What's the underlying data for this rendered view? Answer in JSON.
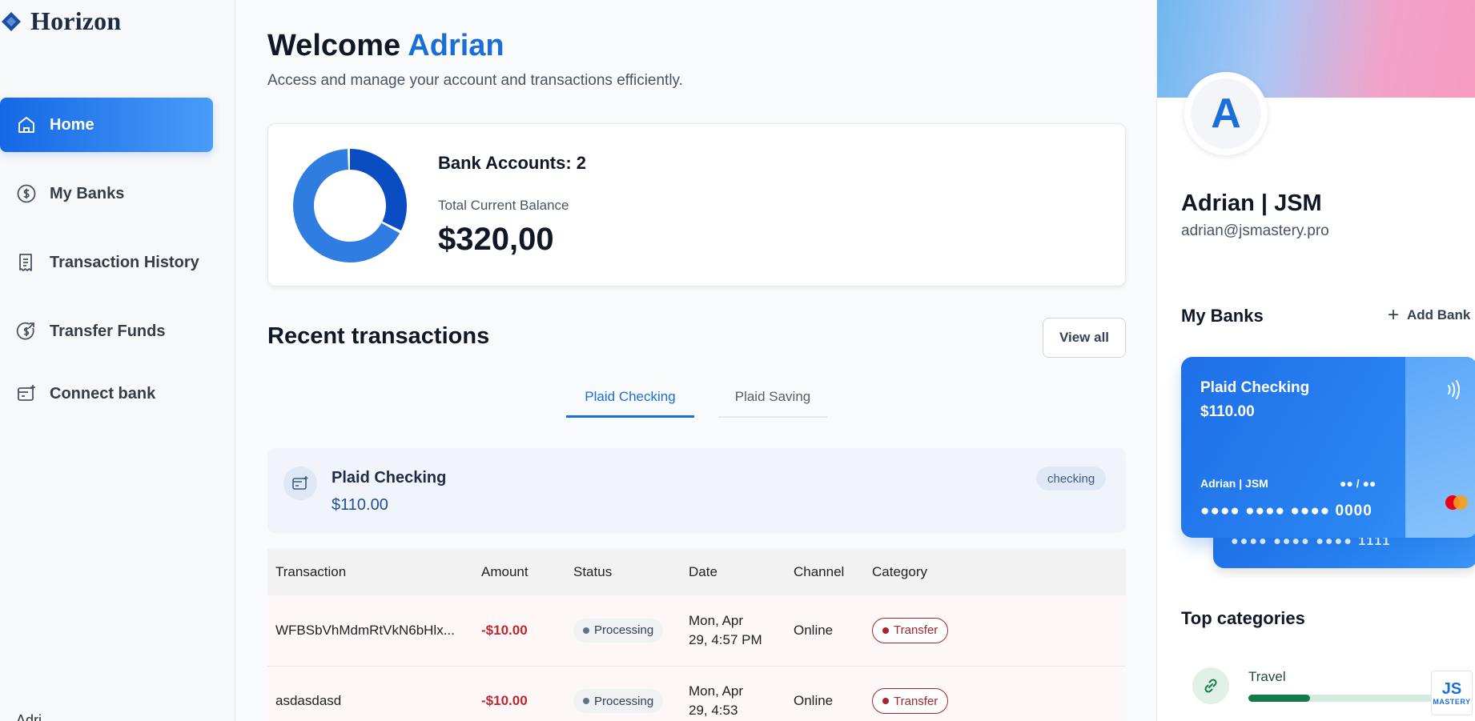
{
  "brand": {
    "name": "Horizon"
  },
  "sidebar": {
    "items": [
      {
        "label": "Home",
        "icon": "home-icon",
        "active": true
      },
      {
        "label": "My Banks",
        "icon": "dollar-circle-icon",
        "active": false
      },
      {
        "label": "Transaction History",
        "icon": "receipt-icon",
        "active": false
      },
      {
        "label": "Transfer Funds",
        "icon": "transfer-funds-icon",
        "active": false
      },
      {
        "label": "Connect bank",
        "icon": "connect-bank-icon",
        "active": false
      }
    ],
    "footer_user": "Adri"
  },
  "header": {
    "greeting": "Welcome",
    "user_first_name": "Adrian",
    "subtitle": "Access and manage your account and transactions efficiently."
  },
  "balance": {
    "accounts_label": "Bank Accounts: 2",
    "total_label": "Total Current Balance",
    "total_value": "$320,00",
    "donut_segments": [
      {
        "share": 0.33,
        "color": "#0a4cc2"
      },
      {
        "share": 0.67,
        "color": "#2f7de1"
      }
    ]
  },
  "recent": {
    "title": "Recent transactions",
    "view_all": "View all",
    "tabs": [
      {
        "label": "Plaid Checking",
        "active": true
      },
      {
        "label": "Plaid Saving",
        "active": false
      }
    ],
    "account": {
      "name": "Plaid Checking",
      "amount": "$110.00",
      "badge": "checking"
    },
    "columns": [
      "Transaction",
      "Amount",
      "Status",
      "Date",
      "Channel",
      "Category"
    ],
    "rows": [
      {
        "name": "WFBSbVhMdmRtVkN6bHlx...",
        "amount": "-$10.00",
        "status": "Processing",
        "date_line1": "Mon, Apr",
        "date_line2": "29, 4:57 PM",
        "channel": "Online",
        "category": "Transfer"
      },
      {
        "name": "asdasdasd",
        "amount": "-$10.00",
        "status": "Processing",
        "date_line1": "Mon, Apr",
        "date_line2": "29, 4:53",
        "channel": "Online",
        "category": "Transfer"
      }
    ]
  },
  "profile": {
    "avatar_letter": "A",
    "name": "Adrian | JSM",
    "email": "adrian@jsmastery.pro"
  },
  "my_banks": {
    "title": "My Banks",
    "add_label": "Add Bank",
    "card": {
      "bank_name": "Plaid Checking",
      "balance": "$110.00",
      "holder": "Adrian | JSM",
      "expiry": "●● / ●●",
      "number": "●●●● ●●●● ●●●● 0000",
      "back_number": "●●●● ●●●● ●●●● 1111"
    }
  },
  "top_categories": {
    "title": "Top categories",
    "items": [
      {
        "label": "Travel",
        "progress": 0.32
      }
    ]
  },
  "watermark": {
    "logo": "JS",
    "text": "MASTERY"
  },
  "colors": {
    "accent": "#1a6ed8",
    "negative": "#c0272d",
    "category_green": "#137a4a"
  }
}
